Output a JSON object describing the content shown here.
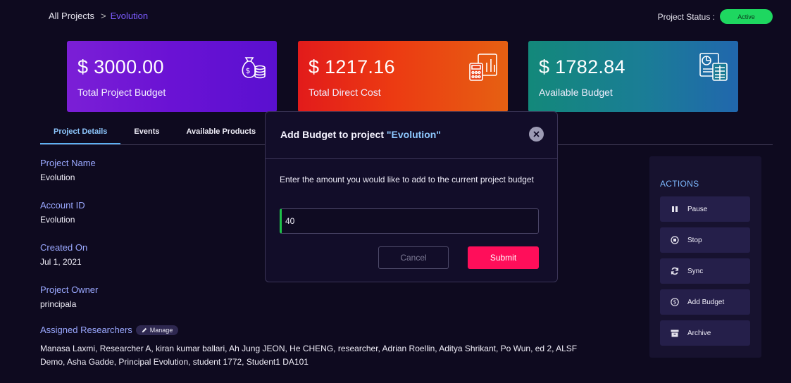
{
  "breadcrumb": {
    "root": "All Projects",
    "separator": ">",
    "current": "Evolution"
  },
  "status": {
    "label": "Project Status :",
    "value": "Active",
    "color": "#1ed760"
  },
  "cards": [
    {
      "amount": "$ 3000.00",
      "label": "Total Project Budget",
      "icon": "money-bag-coins-icon"
    },
    {
      "amount": "$ 1217.16",
      "label": "Total Direct Cost",
      "icon": "calculator-chart-icon"
    },
    {
      "amount": "$ 1782.84",
      "label": "Available Budget",
      "icon": "budget-report-icon"
    }
  ],
  "tabs": [
    {
      "label": "Project Details",
      "active": true
    },
    {
      "label": "Events",
      "active": false
    },
    {
      "label": "Available Products",
      "active": false
    }
  ],
  "details": {
    "project_name_label": "Project Name",
    "project_name": "Evolution",
    "account_id_label": "Account ID",
    "account_id": "Evolution",
    "created_on_label": "Created On",
    "created_on": "Jul 1, 2021",
    "owner_label": "Project Owner",
    "owner": "principala",
    "researchers_label": "Assigned Researchers",
    "manage_label": "Manage",
    "researchers": "Manasa Laxmi, Researcher A, kiran kumar ballari, Ah Jung JEON, He CHENG, researcher, Adrian Roellin, Aditya Shrikant, Po Wun, ed 2, ALSF Demo, Asha Gadde, Principal Evolution, student 1772, Student1 DA101"
  },
  "actions": {
    "title": "ACTIONS",
    "items": [
      {
        "label": "Pause",
        "icon": "pause-icon"
      },
      {
        "label": "Stop",
        "icon": "stop-icon"
      },
      {
        "label": "Sync",
        "icon": "sync-icon"
      },
      {
        "label": "Add Budget",
        "icon": "dollar-coin-icon"
      },
      {
        "label": "Archive",
        "icon": "archive-icon"
      }
    ]
  },
  "modal": {
    "title_prefix": "Add Budget to project ",
    "title_project": "\"Evolution\"",
    "message": "Enter the amount you would like to add to the current project budget",
    "amount_value": "40",
    "cancel_label": "Cancel",
    "submit_label": "Submit"
  },
  "colors": {
    "background": "#0e0a1f",
    "accent_blue": "#8ec8ff",
    "submit": "#ff0e5a",
    "active_status": "#1ed760"
  }
}
